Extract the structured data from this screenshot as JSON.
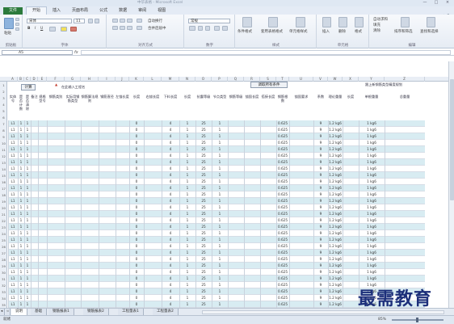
{
  "window": {
    "title": "中华表格 - Microsoft Excel",
    "controls": [
      "—",
      "□",
      "×"
    ]
  },
  "ribbon_tabs": [
    "文件",
    "开始",
    "插入",
    "页面布局",
    "公式",
    "数据",
    "审阅",
    "视图"
  ],
  "ribbon": {
    "clipboard": {
      "name": "剪贴板",
      "paste": "粘贴"
    },
    "font": {
      "name": "字体",
      "font_family": "宋体",
      "font_size": "11"
    },
    "alignment": {
      "name": "对齐方式",
      "wrap": "自动换行",
      "merge": "合并后居中"
    },
    "number": {
      "name": "数字",
      "format": "常规"
    },
    "styles": {
      "name": "样式",
      "cond": "条件格式",
      "table": "套用表格格式",
      "cell": "单元格样式"
    },
    "cells": {
      "name": "单元格",
      "insert": "插入",
      "delete": "删除",
      "format": "格式"
    },
    "editing": {
      "name": "编辑",
      "sum": "自动求和",
      "fill": "填充",
      "clear": "清除",
      "sort": "排序和筛选",
      "find": "查找和选择"
    }
  },
  "formula_bar": {
    "name_box": "A5",
    "fx": "fx",
    "content": ""
  },
  "columns": [
    "A",
    "B",
    "C",
    "D",
    "E",
    "F",
    "G",
    "H",
    "I",
    "J",
    "K",
    "L",
    "M",
    "N",
    "O",
    "P",
    "Q",
    "R",
    "S",
    "T",
    "U",
    "V",
    "W",
    "X",
    "Y",
    "Z"
  ],
  "header_block": {
    "top_button": "计算",
    "section_label": "在此输入工程名",
    "mid_button": "调取所有条件",
    "right_title": "跟上新钢筋类型精度规划",
    "col_labels": [
      "实体号",
      "是否计数",
      "是否清除",
      "备注",
      "规格型号",
      "钢筋类别",
      "实际用钢筋类型",
      "钢筋算法规则",
      "钢筋直径",
      "左锚长度",
      "长度",
      "右锚长度",
      "下料长度",
      "长度",
      "抗震等级",
      "节点类型",
      "钢筋等级",
      "锚固长度",
      "搭接长度",
      "钢筋根数",
      "锚固要求",
      "系数",
      "理论重量",
      "长度",
      "单根重量",
      "总重量"
    ]
  },
  "row_numbers": [
    "1",
    "2",
    "3",
    "4",
    "5",
    "6",
    "7",
    "8",
    "9",
    "10",
    "11",
    "12",
    "13",
    "14",
    "15",
    "16",
    "17",
    "18",
    "19",
    "20",
    "21",
    "22",
    "23",
    "24",
    "25",
    "26",
    "27",
    "28",
    "29",
    "30",
    "31",
    "32",
    "33",
    "34",
    "35",
    "36"
  ],
  "data_rows": [
    [
      "L1",
      "1",
      "1",
      "0",
      "4",
      "1",
      "25",
      "1",
      "0.625",
      "9",
      "1.2 kg6",
      "1 kg6"
    ],
    [
      "L1",
      "1",
      "1",
      "0",
      "4",
      "1",
      "25",
      "1",
      "0.625",
      "9",
      "1.2 kg6",
      "1 kg6"
    ],
    [
      "L1",
      "1",
      "1",
      "0",
      "4",
      "1",
      "25",
      "1",
      "0.625",
      "9",
      "1.2 kg6",
      "1 kg6"
    ],
    [
      "L1",
      "1",
      "1",
      "0",
      "4",
      "1",
      "25",
      "1",
      "0.625",
      "9",
      "1.2 kg6",
      "1 kg6"
    ],
    [
      "L1",
      "1",
      "1",
      "0",
      "4",
      "1",
      "25",
      "1",
      "0.625",
      "9",
      "1.2 kg6",
      "1 kg6"
    ],
    [
      "L1",
      "1",
      "1",
      "0",
      "4",
      "1",
      "25",
      "1",
      "0.625",
      "9",
      "1.2 kg6",
      "1 kg6"
    ],
    [
      "L1",
      "1",
      "1",
      "0",
      "4",
      "1",
      "25",
      "1",
      "0.625",
      "9",
      "1.2 kg6",
      "1 kg6"
    ],
    [
      "L1",
      "1",
      "1",
      "0",
      "4",
      "1",
      "25",
      "1",
      "0.625",
      "9",
      "1.2 kg6",
      "1 kg6"
    ],
    [
      "L1",
      "1",
      "1",
      "0",
      "4",
      "1",
      "25",
      "1",
      "0.625",
      "9",
      "1.2 kg6",
      "1 kg6"
    ],
    [
      "L1",
      "1",
      "1",
      "0",
      "4",
      "1",
      "25",
      "1",
      "0.625",
      "9",
      "1.2 kg6",
      "1 kg6"
    ],
    [
      "L1",
      "1",
      "1",
      "0",
      "4",
      "1",
      "25",
      "1",
      "0.625",
      "9",
      "1.2 kg6",
      "1 kg6"
    ],
    [
      "L1",
      "1",
      "1",
      "0",
      "4",
      "1",
      "25",
      "1",
      "0.625",
      "9",
      "1.2 kg6",
      "1 kg6"
    ],
    [
      "L1",
      "1",
      "1",
      "0",
      "4",
      "1",
      "25",
      "1",
      "0.625",
      "9",
      "1.2 kg6",
      "1 kg6"
    ],
    [
      "L1",
      "1",
      "1",
      "0",
      "4",
      "1",
      "25",
      "1",
      "0.625",
      "9",
      "1.2 kg6",
      "1 kg6"
    ],
    [
      "L1",
      "1",
      "1",
      "0",
      "4",
      "1",
      "25",
      "1",
      "0.625",
      "9",
      "1.2 kg6",
      "1 kg6"
    ],
    [
      "L1",
      "1",
      "1",
      "0",
      "4",
      "1",
      "25",
      "1",
      "0.625",
      "9",
      "1.2 kg6",
      "1 kg6"
    ],
    [
      "L1",
      "1",
      "1",
      "0",
      "4",
      "1",
      "25",
      "1",
      "0.625",
      "9",
      "1.2 kg6",
      "1 kg6"
    ],
    [
      "L1",
      "1",
      "1",
      "0",
      "4",
      "1",
      "25",
      "1",
      "0.625",
      "9",
      "1.2 kg6",
      "1 kg6"
    ],
    [
      "L1",
      "1",
      "1",
      "0",
      "4",
      "1",
      "25",
      "1",
      "0.625",
      "9",
      "1.2 kg6",
      "1 kg6"
    ],
    [
      "L1",
      "1",
      "1",
      "0",
      "4",
      "1",
      "25",
      "1",
      "0.625",
      "9",
      "1.2 kg6",
      "1 kg6"
    ],
    [
      "L1",
      "1",
      "1",
      "0",
      "4",
      "1",
      "25",
      "1",
      "0.625",
      "9",
      "1.2 kg6",
      "1 kg6"
    ],
    [
      "L1",
      "1",
      "1",
      "0",
      "4",
      "1",
      "25",
      "1",
      "0.625",
      "9",
      "1.2 kg6",
      "1 kg6"
    ],
    [
      "L1",
      "1",
      "1",
      "0",
      "4",
      "1",
      "25",
      "1",
      "0.625",
      "9",
      "1.2 kg6",
      "1 kg6"
    ],
    [
      "L1",
      "1",
      "1",
      "0",
      "4",
      "1",
      "25",
      "1",
      "0.625",
      "9",
      "1.2 kg6",
      "1 kg6"
    ],
    [
      "L1",
      "1",
      "1",
      "0",
      "4",
      "1",
      "25",
      "1",
      "0.625",
      "9",
      "1.2 kg6",
      "1 kg6"
    ],
    [
      "L1",
      "1",
      "1",
      "0",
      "4",
      "1",
      "25",
      "1",
      "0.625",
      "9",
      "1.2 kg6",
      "1 kg6"
    ],
    [
      "L1",
      "1",
      "1",
      "0",
      "4",
      "1",
      "25",
      "1",
      "0.625",
      "9",
      "1.2 kg6",
      "1 kg6"
    ],
    [
      "L1",
      "1",
      "1",
      "0",
      "4",
      "1",
      "25",
      "1",
      "0.625",
      "9",
      "1.2 kg6",
      "1 kg6"
    ],
    [
      "L1",
      "1",
      "1",
      "0",
      "4",
      "1",
      "25",
      "1",
      "0.625",
      "9",
      "1.2 kg6",
      "1 kg6"
    ],
    [
      "L1",
      "1",
      "1",
      "0",
      "4",
      "1",
      "25",
      "1",
      "0.625",
      "9",
      "1.2 kg6",
      "1 kg6"
    ]
  ],
  "sheet_tabs": [
    "说明",
    "基础",
    "钢筋报表1",
    "钢筋报表2",
    "工程量表1",
    "工程量表2"
  ],
  "status": {
    "ready": "就绪",
    "zoom": "85%"
  },
  "watermark": "最需教育",
  "colors": {
    "file_tab": "#2b7a3c",
    "row_tint": "#d8ecf2",
    "watermark": "#1c2f7a"
  }
}
